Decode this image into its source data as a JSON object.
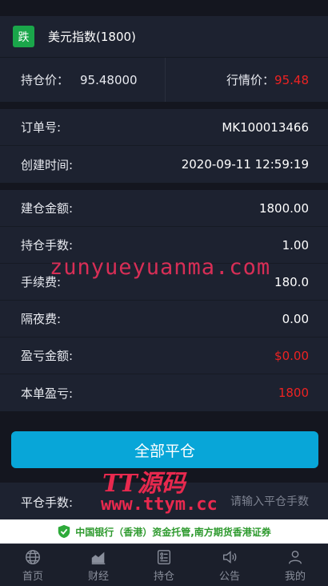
{
  "header": {
    "badge": "跌",
    "title": "美元指数(1800)"
  },
  "prices": {
    "hold_label": "持仓价：",
    "hold_value": "95.48000",
    "market_label": "行情价：",
    "market_value": "95.48"
  },
  "order": {
    "order_no_label": "订单号:",
    "order_no_value": "MK100013466",
    "created_label": "创建时间:",
    "created_value": "2020-09-11 12:59:19"
  },
  "details": [
    {
      "label": "建仓金额:",
      "value": "1800.00",
      "red": false
    },
    {
      "label": "持仓手数:",
      "value": "1.00",
      "red": false
    },
    {
      "label": "手续费:",
      "value": "180.0",
      "red": false
    },
    {
      "label": "隔夜费:",
      "value": "0.00",
      "red": false
    },
    {
      "label": "盈亏金额:",
      "value": "$0.00",
      "red": true
    },
    {
      "label": "本单盈亏:",
      "value": "1800",
      "red": true
    }
  ],
  "close_all_button": "全部平仓",
  "close_input": {
    "label": "平仓手数:",
    "placeholder": "请输入平仓手数"
  },
  "notice": "中国银行（香港）资金托管,南方期货香港证券",
  "watermarks": {
    "top": "zunyueyuanma.com",
    "logo": "TT源码",
    "url": "www.ttym.cc"
  },
  "tabs": [
    {
      "label": "首页",
      "icon": "globe-icon"
    },
    {
      "label": "财经",
      "icon": "chart-icon"
    },
    {
      "label": "持仓",
      "icon": "position-icon"
    },
    {
      "label": "公告",
      "icon": "speaker-icon"
    },
    {
      "label": "我的",
      "icon": "user-icon"
    }
  ],
  "colors": {
    "background": "#14161f",
    "panel": "#1d2230",
    "accent": "#08a6d8",
    "down_badge": "#1aa64a",
    "loss_red": "#ee2222"
  }
}
